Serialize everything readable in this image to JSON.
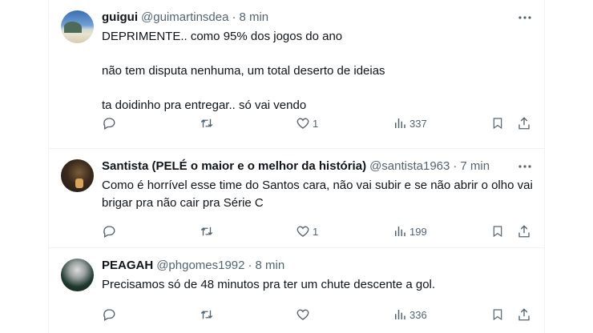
{
  "tweets": [
    {
      "name": "guigui",
      "handle": "@guimartinsdea",
      "time": "8 min",
      "body": [
        "DEPRIMENTE.. como 95% dos jogos do ano",
        "não tem disputa nenhuma, um total deserto de ideias",
        "ta doidinho pra entregar.. só vai vendo"
      ],
      "likes": "1",
      "views": "337"
    },
    {
      "name": "Santista (PELÉ o maior e o melhor da história)",
      "handle": "@santista1963",
      "time": "7 min",
      "body": [
        "Como é horrível esse time do Santos cara, não vai subir e se não abrir o olho vai brigar pra não cair pra Série C"
      ],
      "likes": "1",
      "views": "199"
    },
    {
      "name": "PEAGAH",
      "handle": "@phgomes1992",
      "time": "8 min",
      "body": [
        "Precisamos só de 48 minutos pra ter um chute descente a gol."
      ],
      "likes": "",
      "views": "336"
    }
  ],
  "separator": "·",
  "icons": {
    "more": "more-dots-icon",
    "reply": "reply-icon",
    "retweet": "retweet-icon",
    "like": "heart-icon",
    "views": "views-bar-chart-icon",
    "bookmark": "bookmark-icon",
    "share": "share-icon"
  },
  "colors": {
    "text": "#0f1419",
    "secondary": "#536471",
    "divider": "#eff3f4"
  }
}
